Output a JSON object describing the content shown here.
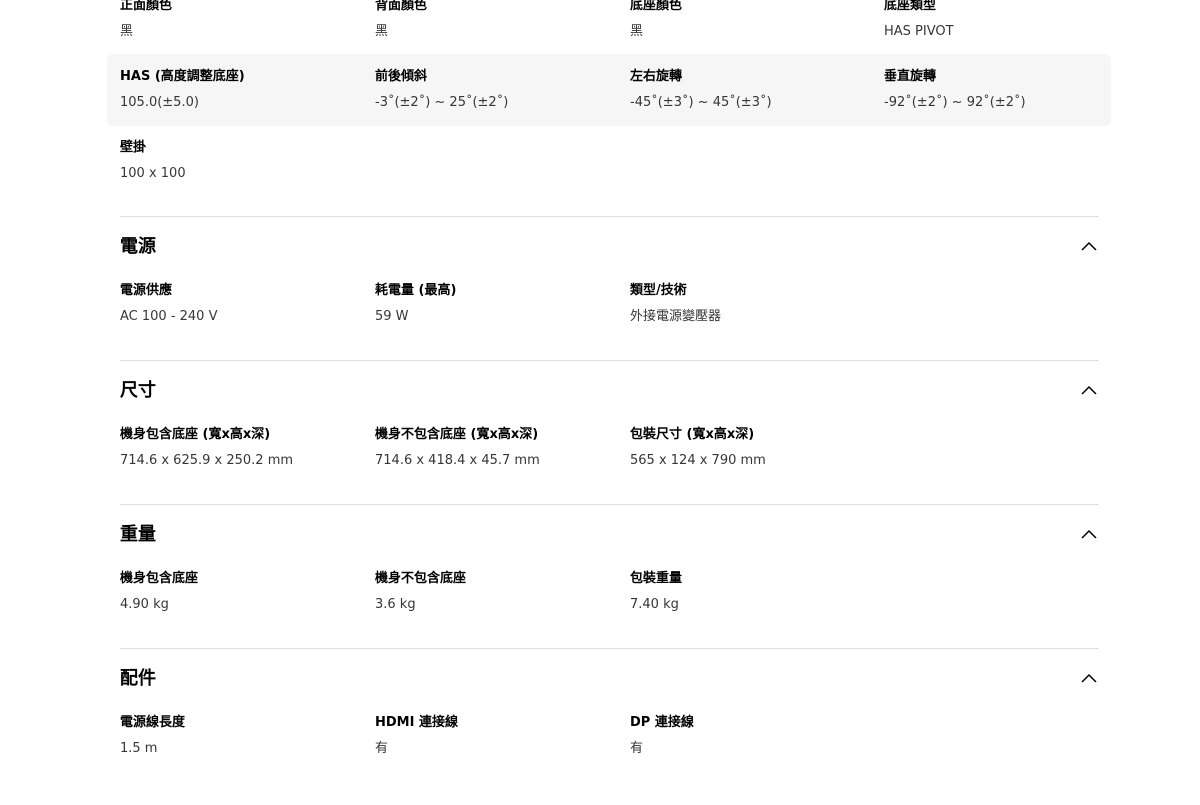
{
  "stand": {
    "rows": [
      [
        {
          "label": "正面顏色",
          "value": "黑"
        },
        {
          "label": "背面顏色",
          "value": "黑"
        },
        {
          "label": "底座顏色",
          "value": "黑"
        },
        {
          "label": "底座類型",
          "value": "HAS PIVOT"
        }
      ],
      [
        {
          "label": "HAS (高度調整底座)",
          "value": "105.0(±5.0)"
        },
        {
          "label": "前後傾斜",
          "value": "-3˚(±2˚) ~ 25˚(±2˚)"
        },
        {
          "label": "左右旋轉",
          "value": "-45˚(±3˚) ~ 45˚(±3˚)"
        },
        {
          "label": "垂直旋轉",
          "value": "-92˚(±2˚) ~ 92˚(±2˚)"
        }
      ],
      [
        {
          "label": "壁掛",
          "value": "100 x 100"
        }
      ]
    ]
  },
  "sections": [
    {
      "title": "電源",
      "items": [
        {
          "label": "電源供應",
          "value": "AC 100 - 240 V"
        },
        {
          "label": "耗電量 (最高)",
          "value": "59 W"
        },
        {
          "label": "類型/技術",
          "value": "外接電源變壓器"
        }
      ]
    },
    {
      "title": "尺寸",
      "items": [
        {
          "label": "機身包含底座 (寬x高x深)",
          "value": "714.6 x 625.9 x 250.2 mm"
        },
        {
          "label": "機身不包含底座 (寬x高x深)",
          "value": "714.6 x 418.4 x 45.7 mm"
        },
        {
          "label": "包裝尺寸 (寬x高x深)",
          "value": "565 x 124 x 790 mm"
        }
      ]
    },
    {
      "title": "重量",
      "items": [
        {
          "label": "機身包含底座",
          "value": "4.90 kg"
        },
        {
          "label": "機身不包含底座",
          "value": "3.6 kg"
        },
        {
          "label": "包裝重量",
          "value": "7.40 kg"
        }
      ]
    },
    {
      "title": "配件",
      "items": [
        {
          "label": "電源線長度",
          "value": "1.5 m"
        },
        {
          "label": "HDMI 連接線",
          "value": "有"
        },
        {
          "label": "DP 連接線",
          "value": "有"
        }
      ]
    }
  ],
  "icons": {
    "collapse": "chevron-up-icon"
  },
  "colors": {
    "highlight_row": "#f6f6f6",
    "divider": "#dddddd",
    "value_text": "#363636"
  }
}
